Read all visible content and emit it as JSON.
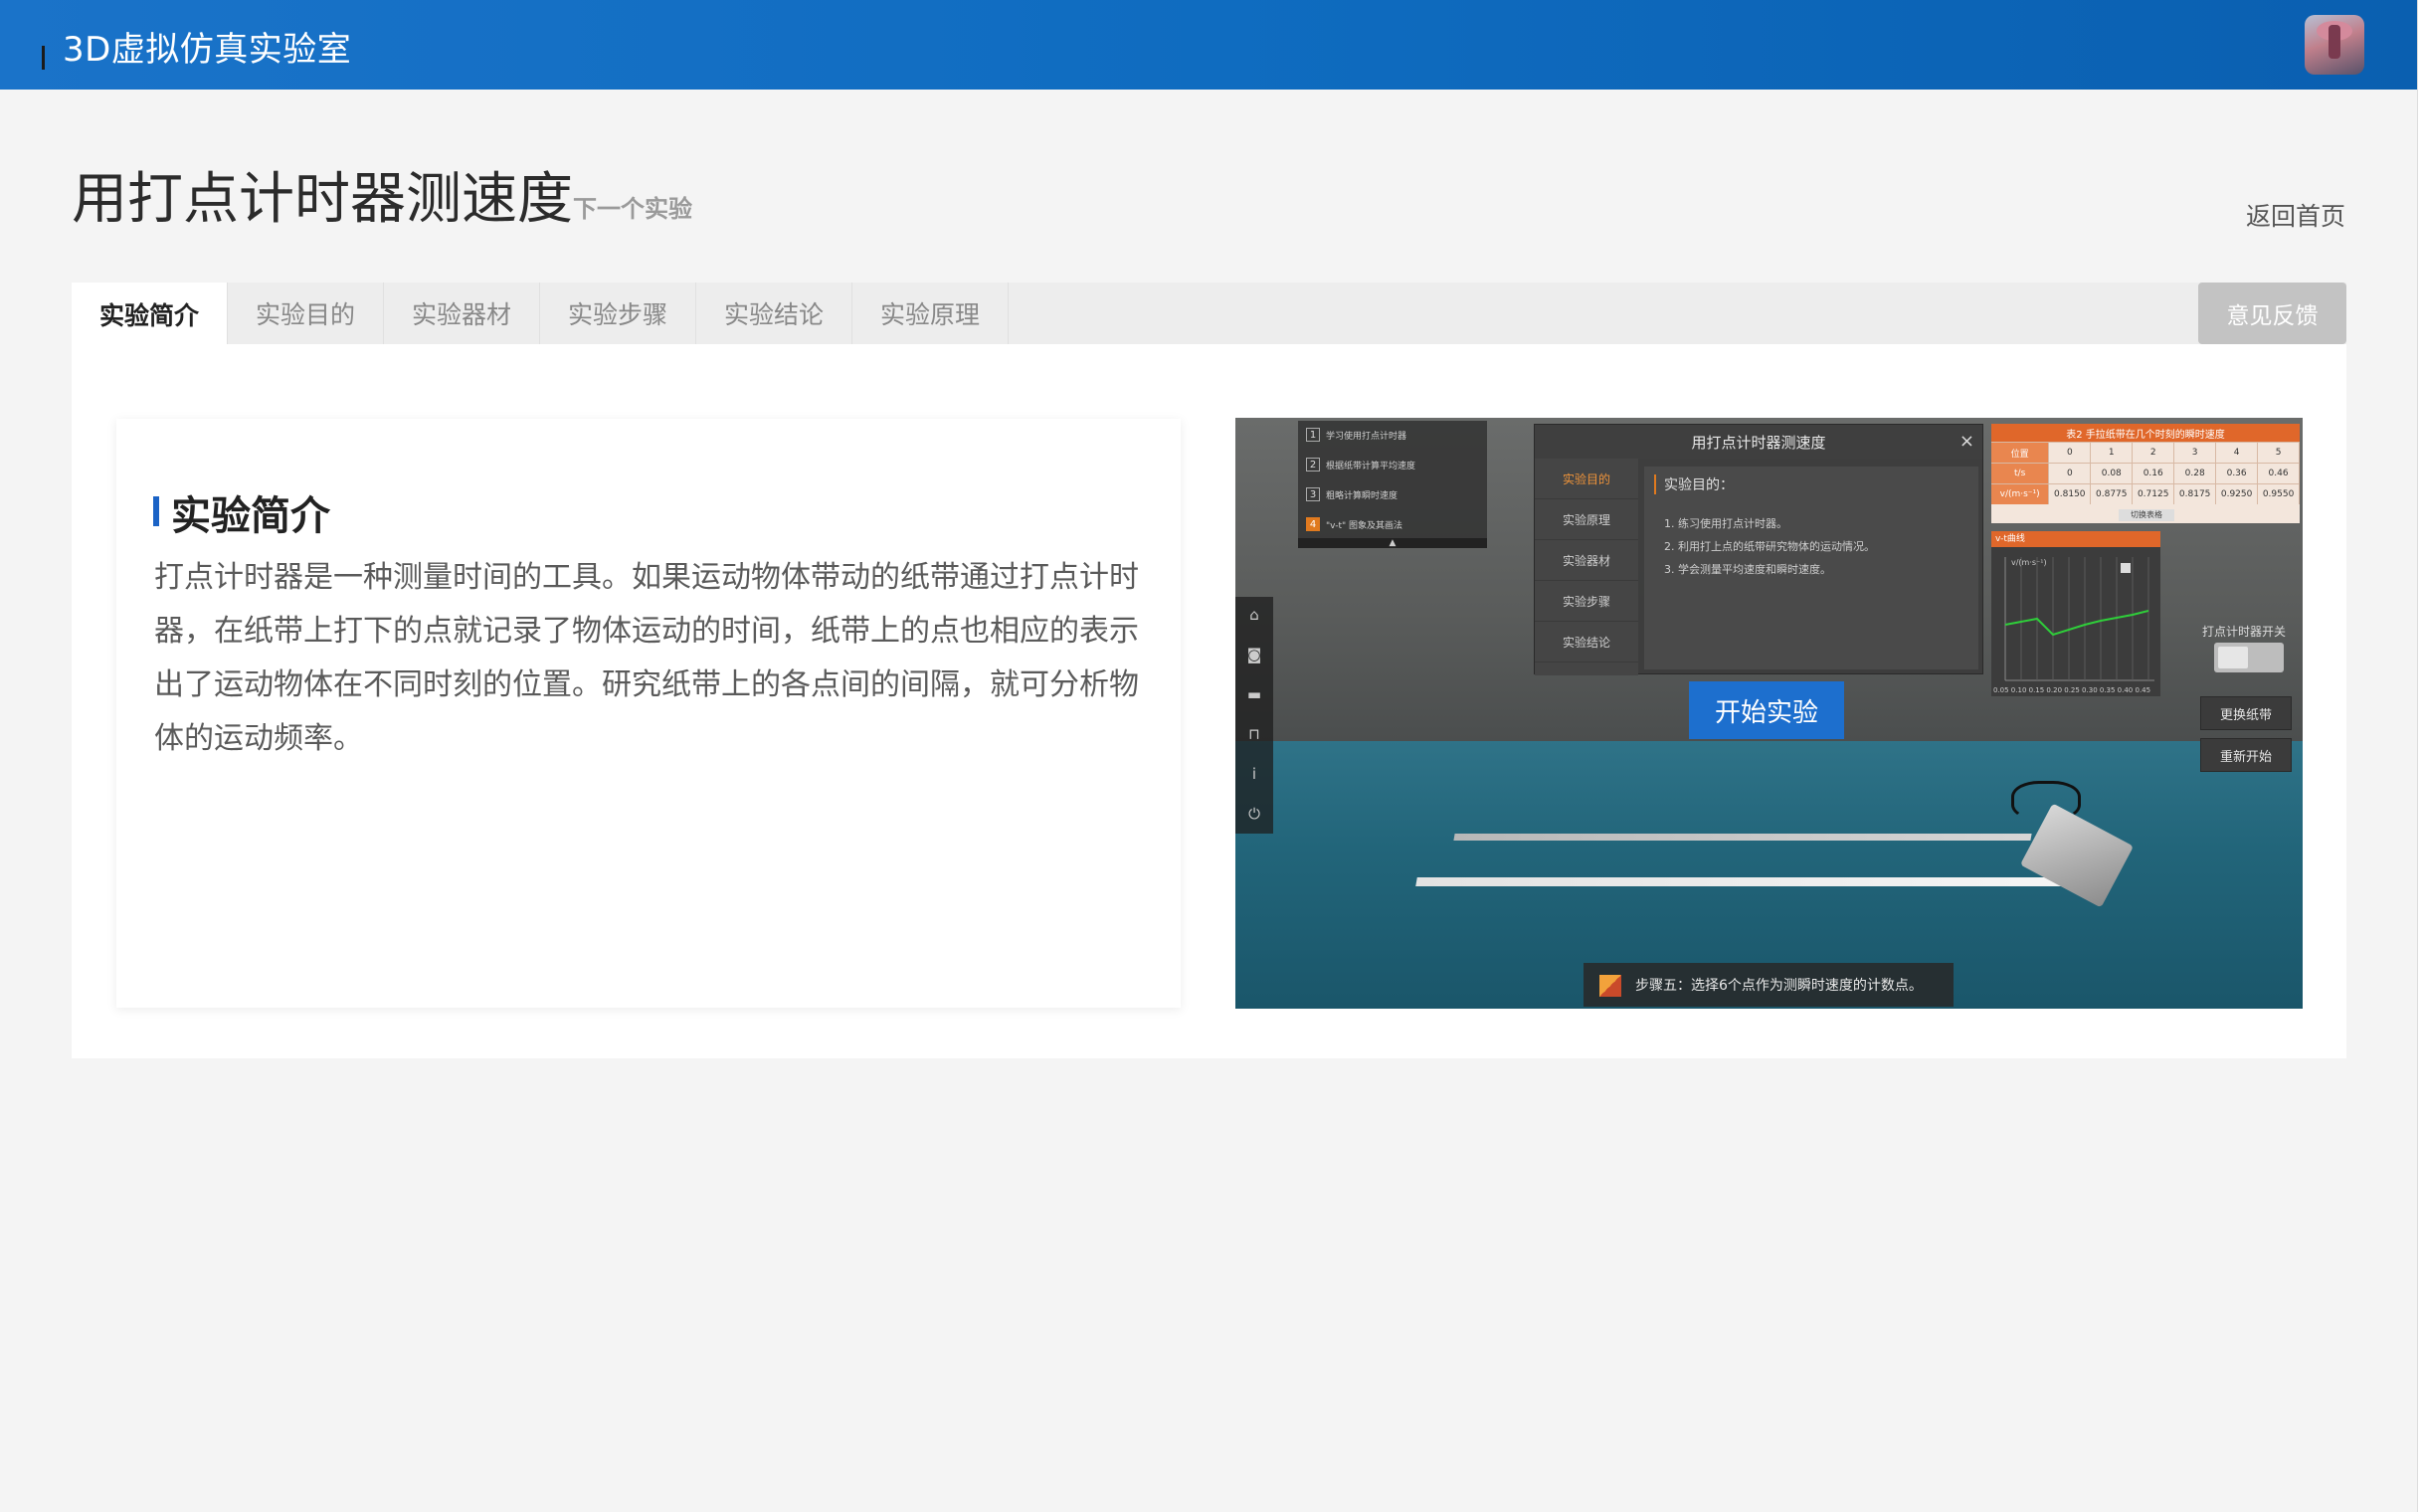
{
  "header": {
    "app_title": "3D虚拟仿真实验室"
  },
  "page": {
    "title": "用打点计时器测速度",
    "next_label": "下一个实验",
    "home_label": "返回首页"
  },
  "tabs": [
    {
      "label": "实验简介",
      "active": true
    },
    {
      "label": "实验目的",
      "active": false
    },
    {
      "label": "实验器材",
      "active": false
    },
    {
      "label": "实验步骤",
      "active": false
    },
    {
      "label": "实验结论",
      "active": false
    },
    {
      "label": "实验原理",
      "active": false
    }
  ],
  "feedback_label": "意见反馈",
  "intro": {
    "heading": "实验简介",
    "body": "打点计时器是一种测量时间的工具。如果运动物体带动的纸带通过打点计时器，在纸带上打下的点就记录了物体运动的时间，纸带上的点也相应的表示出了运动物体在不同时刻的位置。研究纸带上的各点间的间隔，就可分析物体的运动频率。"
  },
  "simulation": {
    "steps": [
      {
        "num": "1",
        "label": "学习使用打点计时器"
      },
      {
        "num": "2",
        "label": "根据纸带计算平均速度"
      },
      {
        "num": "3",
        "label": "粗略计算瞬时速度"
      },
      {
        "num": "4",
        "label": "\"v-t\" 图象及其画法"
      }
    ],
    "dialog": {
      "title": "用打点计时器测速度",
      "close": "×",
      "menu": [
        "实验目的",
        "实验原理",
        "实验器材",
        "实验步骤",
        "实验结论"
      ],
      "body_heading": "实验目的：",
      "body_items": [
        "1. 练习使用打点计时器。",
        "2. 利用打上点的纸带研究物体的运动情况。",
        "3. 学会测量平均速度和瞬时速度。"
      ]
    },
    "start_label": "开始实验",
    "table": {
      "title": "表2 手拉纸带在几个时刻的瞬时速度",
      "header": [
        "位置",
        "0",
        "1",
        "2",
        "3",
        "4",
        "5"
      ],
      "rows": [
        [
          "t/s",
          "0",
          "0.08",
          "0.16",
          "0.28",
          "0.36",
          "0.46"
        ],
        [
          "v/(m·s⁻¹)",
          "0.8150",
          "0.8775",
          "0.7125",
          "0.8175",
          "0.9250",
          "0.9550"
        ]
      ],
      "switch_label": "切换表格"
    },
    "graph_title": "v-t曲线",
    "graph_x_ticks": "0.05 0.10 0.15 0.20 0.25 0.30 0.35 0.40 0.45",
    "switch_label": "打点计时器开关",
    "change_tape_label": "更换纸带",
    "restart_label": "重新开始",
    "status_text": "步骤五：选择6个点作为测瞬时速度的计数点。"
  }
}
